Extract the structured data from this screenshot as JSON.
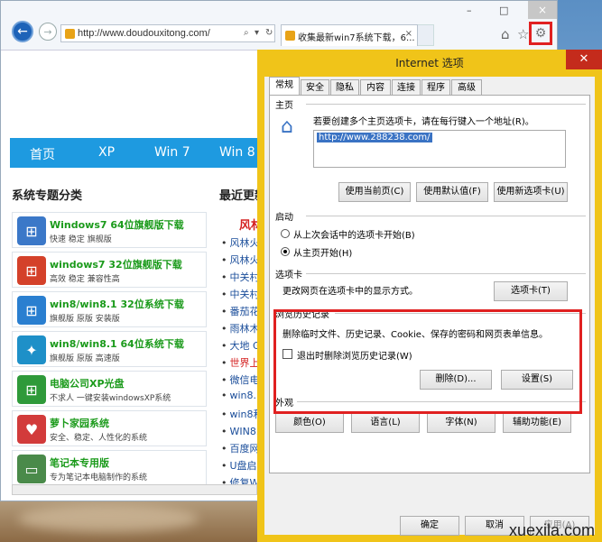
{
  "browser": {
    "address": "http://www.doudouxitong.com/",
    "tab_title": "收集最新win7系统下载，6...",
    "tab_close": "×",
    "close": "×",
    "minimize": "–",
    "maximize": "□"
  },
  "site": {
    "nav": [
      "首页",
      "XP",
      "Win 7",
      "Win 8"
    ],
    "section_title": "系统专题分类",
    "right_title": "最近更新",
    "cards": [
      {
        "title": "Windows7 64位旗舰版下载",
        "sub": "快速 稳定 旗舰版",
        "color": "#3b78c8"
      },
      {
        "title": "windows7 32位旗舰版下载",
        "sub": "高效 稳定 兼容性高",
        "color": "#d4412a"
      },
      {
        "title": "win8/win8.1 32位系统下载",
        "sub": "旗舰版 原版 安装版",
        "color": "#2a7fd0"
      },
      {
        "title": "win8/win8.1 64位系统下载",
        "sub": "旗舰版 原版 高速版",
        "color": "#1e90c8"
      },
      {
        "title": "电脑公司XP光盘",
        "sub": "不求人 一键安装windowsXP系统",
        "color": "#2f9a3a"
      },
      {
        "title": "萝卜家园系统",
        "sub": "安全、稳定、人性化的系统",
        "color": "#d23b3b"
      },
      {
        "title": "笔记本专用版",
        "sub": "专为笔记本电脑制作的系统",
        "color": "#4a8a4a"
      }
    ],
    "news_head": "风林",
    "news": [
      "风林火",
      "风林火",
      "中关村",
      "中关村",
      "番茄花",
      "雨林木",
      "大地 G",
      "世界上",
      "微信电",
      "win8.1",
      "win8和",
      "WIN8系",
      "百度网",
      "U盘启",
      "修复Wi"
    ]
  },
  "dialog": {
    "title": "Internet 选项",
    "close": "✕",
    "tabs": [
      "常规",
      "安全",
      "隐私",
      "内容",
      "连接",
      "程序",
      "高级"
    ],
    "home": {
      "label": "主页",
      "desc": "若要创建多个主页选项卡，请在每行键入一个地址(R)。",
      "url": "http://www.288238.com/",
      "btn_current": "使用当前页(C)",
      "btn_default": "使用默认值(F)",
      "btn_new_tab": "使用新选项卡(U)"
    },
    "startup": {
      "label": "启动",
      "opt1": "从上次会话中的选项卡开始(B)",
      "opt2": "从主页开始(H)"
    },
    "tabs_group": {
      "label": "选项卡",
      "desc": "更改网页在选项卡中的显示方式。",
      "btn": "选项卡(T)"
    },
    "history": {
      "label": "浏览历史记录",
      "desc": "删除临时文件、历史记录、Cookie、保存的密码和网页表单信息。",
      "checkbox": "退出时删除浏览历史记录(W)",
      "btn_delete": "删除(D)...",
      "btn_settings": "设置(S)"
    },
    "appearance": {
      "label": "外观",
      "btn_colors": "颜色(O)",
      "btn_language": "语言(L)",
      "btn_fonts": "字体(N)",
      "btn_access": "辅助功能(E)"
    },
    "ok": "确定",
    "cancel": "取消",
    "apply": "应用(A)"
  },
  "watermark": "xuexila.com"
}
